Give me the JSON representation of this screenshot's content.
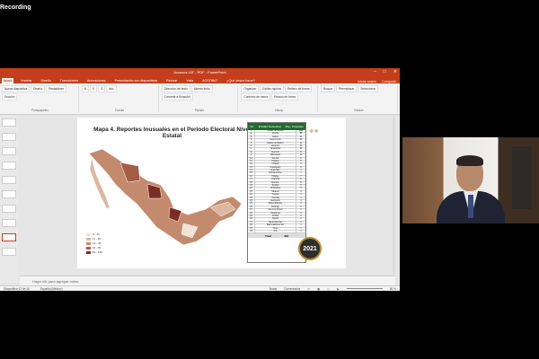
{
  "recording": "Recording",
  "window": {
    "title": "Accesos UIF - PDF - PowerPoint"
  },
  "tabs": [
    "Inicio",
    "Insertar",
    "Diseño",
    "Transiciones",
    "Animaciones",
    "Presentación con diapositivas",
    "Revisar",
    "Vista",
    "ACROBAT",
    "¿Qué desea hacer?"
  ],
  "tabs_right": [
    "Iniciar sesión",
    "Compartir"
  ],
  "ribbon": {
    "groups": [
      {
        "label": "Portapapeles",
        "items": [
          "Nueva diapositiva",
          "Diseño",
          "Restablecer",
          "Sección"
        ]
      },
      {
        "label": "Fuente",
        "items": [
          "N",
          "K",
          "S",
          "abc"
        ]
      },
      {
        "label": "Párrafo",
        "items": [
          "Dirección del texto",
          "Alinear texto",
          "Convertir a SmartArt"
        ]
      },
      {
        "label": "Dibujo",
        "items": [
          "Organizar",
          "Estilos rápidos",
          "Relleno de forma",
          "Contorno de forma",
          "Efectos de forma"
        ]
      },
      {
        "label": "Edición",
        "items": [
          "Buscar",
          "Reemplazar",
          "Seleccionar"
        ]
      }
    ]
  },
  "slide": {
    "title": "Mapa 4. Reportes Inusuales en el Periodo Electoral Nivel Estatal",
    "legend": [
      "0 - 10",
      "11 - 20",
      "21 - 40",
      "41 - 80",
      "81 - 153"
    ],
    "legend_colors": [
      "#f1e3d6",
      "#dcb8a0",
      "#c48a6e",
      "#a55c46",
      "#7c2d22"
    ],
    "table_headers": [
      "No.",
      "Entidad Federativa",
      "Rep. Inusuales"
    ],
    "rows": [
      [
        "1",
        "Ciudad de México",
        "153"
      ],
      [
        "2",
        "Puebla",
        "28"
      ],
      [
        "3",
        "Jalisco",
        "22"
      ],
      [
        "4",
        "Nuevo León",
        "20"
      ],
      [
        "5",
        "Estado de México",
        "16"
      ],
      [
        "6",
        "Veracruz",
        "14"
      ],
      [
        "7",
        "Tamaulipas",
        "12"
      ],
      [
        "8",
        "Guerrero",
        "11"
      ],
      [
        "9",
        "Michoacán",
        "10"
      ],
      [
        "10",
        "Sonora",
        "9"
      ],
      [
        "11",
        "Oaxaca",
        "9"
      ],
      [
        "12",
        "Chiapas",
        "8"
      ],
      [
        "13",
        "Guanajuato",
        "8"
      ],
      [
        "14",
        "Querétaro",
        "7"
      ],
      [
        "15",
        "Quintana Roo",
        "7"
      ],
      [
        "16",
        "Hidalgo",
        "7"
      ],
      [
        "17",
        "Coahuila",
        "6"
      ],
      [
        "18",
        "Morelos",
        "5"
      ],
      [
        "19",
        "Sinaloa",
        "5"
      ],
      [
        "20",
        "Chihuahua",
        "5"
      ],
      [
        "21",
        "Tabasco",
        "4"
      ],
      [
        "22",
        "Yucatán",
        "4"
      ],
      [
        "23",
        "Tlaxcala",
        "4"
      ],
      [
        "24",
        "Campeche",
        "3"
      ],
      [
        "25",
        "Baja California",
        "3"
      ],
      [
        "26",
        "Durango",
        "2"
      ],
      [
        "27",
        "San Luis Potosí",
        "2"
      ],
      [
        "28",
        "Zacatecas",
        "2"
      ],
      [
        "29",
        "Colima",
        "2"
      ],
      [
        "30",
        "Nayarit",
        "2"
      ],
      [
        "31",
        "Aguascalientes",
        "1"
      ],
      [
        "32",
        "Baja California Sur",
        "1"
      ],
      [
        "33",
        "Otros",
        "1"
      ],
      [
        "34",
        "N/D",
        "1"
      ]
    ],
    "total_label": "Total",
    "total_value": "403",
    "badge_text": "2021"
  },
  "notes_placeholder": "Haga clic para agregar notas",
  "status": {
    "slide_counter": "Diapositiva 12 de 16",
    "language": "Español (México)",
    "notes": "Notas",
    "comments": "Comentarios",
    "zoom": "66 %"
  }
}
